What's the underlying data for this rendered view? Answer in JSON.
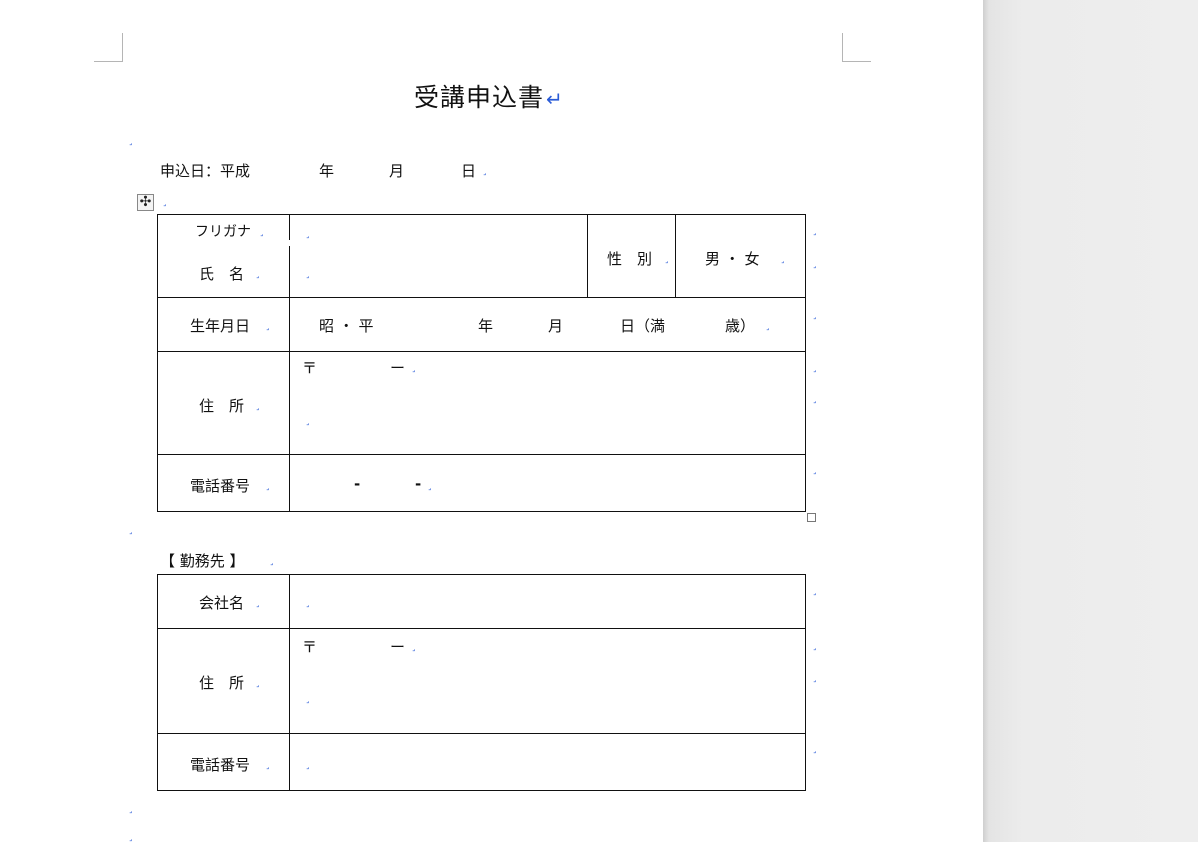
{
  "document": {
    "title": "受講申込書",
    "return_mark": "↵",
    "para_mark": "˼",
    "move_handle_glyph": "✣",
    "application_date": {
      "label": "申込日：平成",
      "year": "年",
      "month": "月",
      "day": "日"
    },
    "applicant_table": {
      "furigana_label": "フリガナ",
      "name_label": "氏　名",
      "gender_label": "性　別",
      "gender_value": "男 ・ 女",
      "birth_label": "生年月日",
      "birth_era": "昭 ・ 平",
      "birth_year": "年",
      "birth_month": "月",
      "birth_day": "日（満",
      "birth_age": "歳）",
      "address_label": "住　所",
      "postal_mark": "〒",
      "postal_dash": "ー",
      "phone_label": "電話番号",
      "phone_sep1": "-",
      "phone_sep2": "-"
    },
    "workplace": {
      "heading": "【 勤務先 】",
      "company_label": "会社名",
      "address_label": "住　所",
      "postal_mark": "〒",
      "postal_dash": "ー",
      "phone_label": "電話番号"
    }
  }
}
